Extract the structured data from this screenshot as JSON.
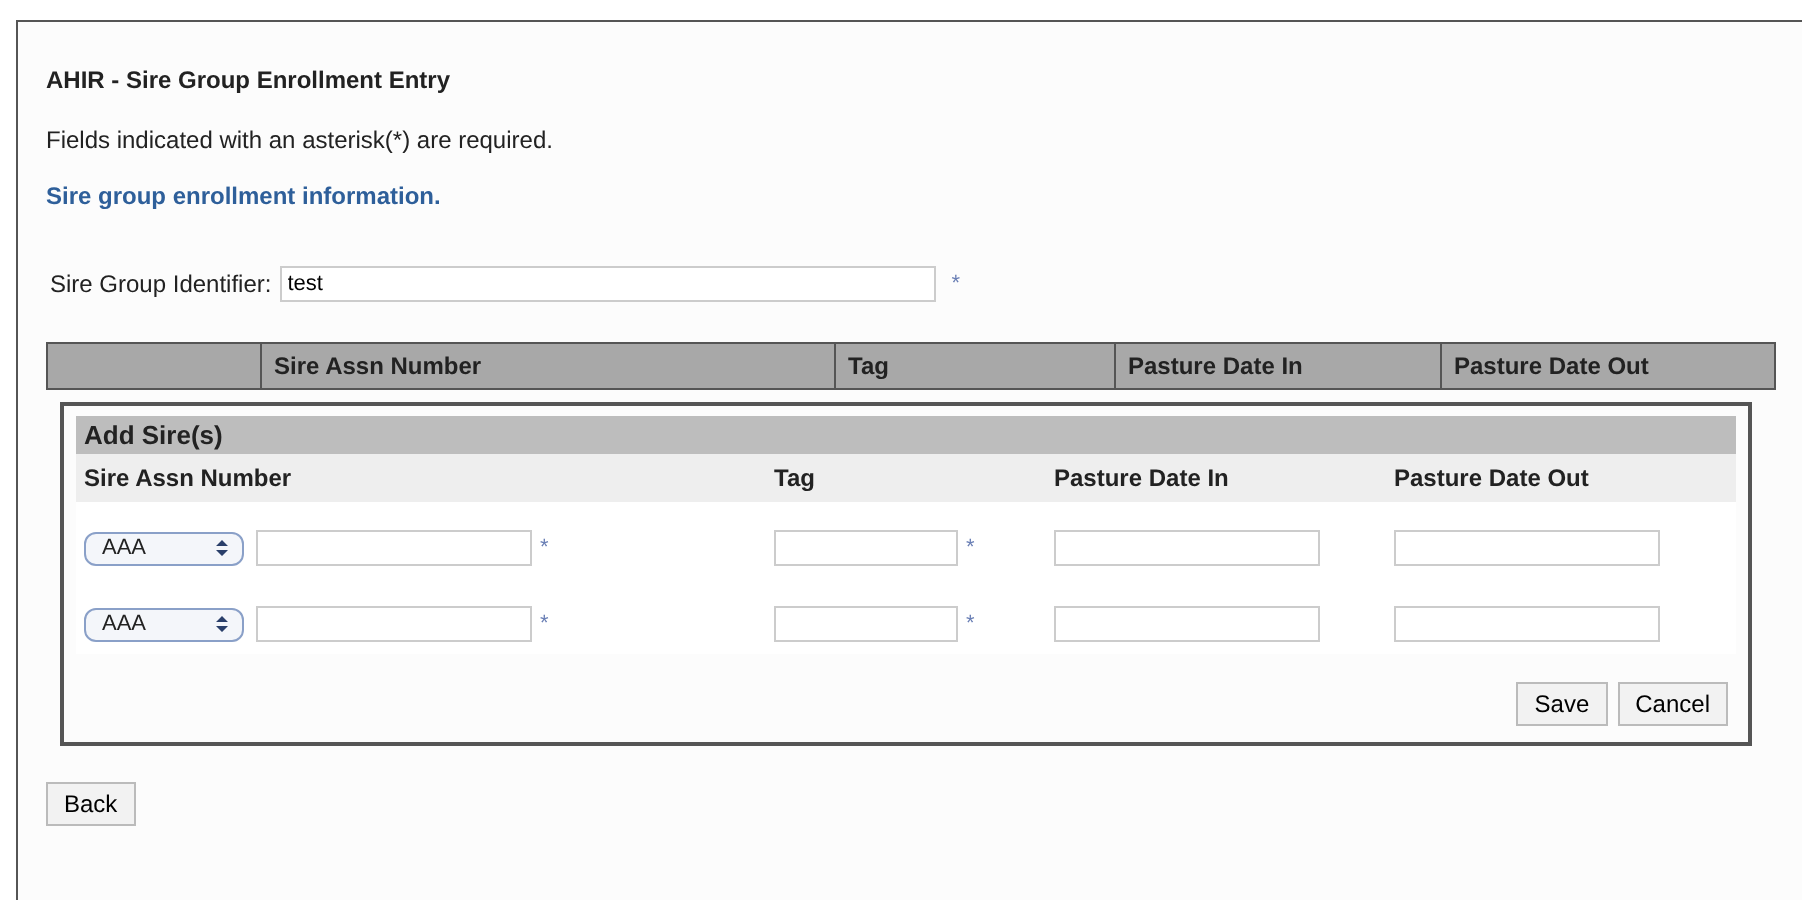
{
  "title": "AHIR - Sire Group Enrollment Entry",
  "note": "Fields indicated with an asterisk(*) are required.",
  "section_link": "Sire group enrollment information.",
  "identifier": {
    "label": "Sire Group Identifier:",
    "value": "test",
    "required_mark": "*"
  },
  "table": {
    "columns": [
      "Sire Assn Number",
      "Tag",
      "Pasture Date In",
      "Pasture Date Out"
    ]
  },
  "add_sires": {
    "title": "Add Sire(s)",
    "columns": [
      "Sire Assn Number",
      "Tag",
      "Pasture Date In",
      "Pasture Date Out"
    ],
    "rows": [
      {
        "breed": "AAA",
        "number_mark": "*",
        "tag_mark": "*"
      },
      {
        "breed": "AAA",
        "number_mark": "*",
        "tag_mark": "*"
      }
    ],
    "buttons": [
      "Save",
      "Cancel"
    ]
  },
  "back_button": "Back"
}
